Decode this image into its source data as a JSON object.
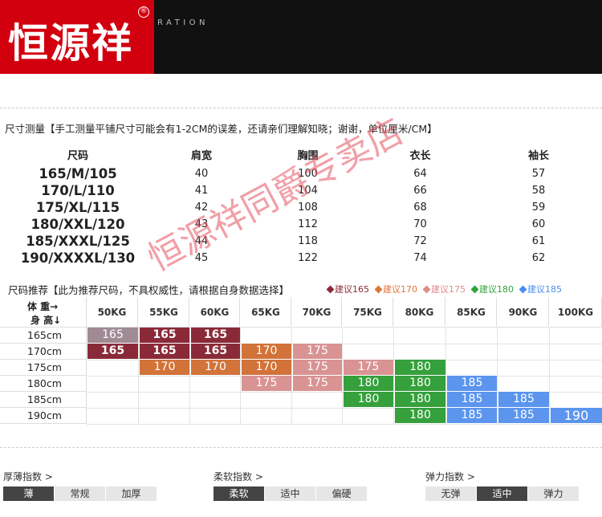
{
  "header": {
    "logo_text": "恒源祥",
    "registered_mark": "®",
    "tagline": "RATION"
  },
  "measure": {
    "title": "尺寸测量【手工测量平铺尺寸可能会有1-2CM的误差，还请亲们理解知晓；谢谢，单位厘米/CM】",
    "headers": [
      "尺码",
      "肩宽",
      "胸围",
      "衣长",
      "袖长"
    ],
    "rows": [
      [
        "165/M/105",
        "40",
        "100",
        "64",
        "57"
      ],
      [
        "170/L/110",
        "41",
        "104",
        "66",
        "58"
      ],
      [
        "175/XL/115",
        "42",
        "108",
        "68",
        "59"
      ],
      [
        "180/XXL/120",
        "43",
        "112",
        "70",
        "60"
      ],
      [
        "185/XXXL/125",
        "44",
        "118",
        "72",
        "61"
      ],
      [
        "190/XXXXL/130",
        "45",
        "122",
        "74",
        "62"
      ]
    ]
  },
  "recommend": {
    "title": "尺码推荐【此为推荐尺码，不具权威性，请根据自身数据选择】",
    "legend": [
      {
        "label": "建议165",
        "color": "#8a2a38"
      },
      {
        "label": "建议170",
        "color": "#e0753a"
      },
      {
        "label": "建议175",
        "color": "#e08a8a"
      },
      {
        "label": "建议180",
        "color": "#2ea43a"
      },
      {
        "label": "建议185",
        "color": "#4a8ef0"
      }
    ],
    "corner_weight": "体 重→",
    "corner_height": "身 高↓",
    "weights": [
      "50KG",
      "55KG",
      "60KG",
      "65KG",
      "70KG",
      "75KG",
      "80KG",
      "85KG",
      "90KG",
      "100KG"
    ],
    "heights": [
      "165cm",
      "170cm",
      "175cm",
      "180cm",
      "185cm",
      "190cm"
    ],
    "colors": {
      "165": "#8a2a38",
      "165a": "#a08a94",
      "170": "#d2733a",
      "175": "#d99393",
      "180": "#35a03c",
      "185": "#5b95ee",
      "190": "#5b95ee"
    },
    "cells": [
      {
        "row": 0,
        "col": 0,
        "label": "165",
        "tone": "165a"
      },
      {
        "row": 0,
        "col": 1,
        "label": "165",
        "tone": "165"
      },
      {
        "row": 0,
        "col": 2,
        "label": "165",
        "tone": "165"
      },
      {
        "row": 1,
        "col": 0,
        "label": "165",
        "tone": "165"
      },
      {
        "row": 1,
        "col": 1,
        "label": "165",
        "tone": "165"
      },
      {
        "row": 1,
        "col": 2,
        "label": "165",
        "tone": "165"
      },
      {
        "row": 1,
        "col": 3,
        "label": "170",
        "tone": "170"
      },
      {
        "row": 1,
        "col": 4,
        "label": "175",
        "tone": "175"
      },
      {
        "row": 2,
        "col": 1,
        "label": "170",
        "tone": "170"
      },
      {
        "row": 2,
        "col": 2,
        "label": "170",
        "tone": "170"
      },
      {
        "row": 2,
        "col": 3,
        "label": "170",
        "tone": "170"
      },
      {
        "row": 2,
        "col": 4,
        "label": "175",
        "tone": "175"
      },
      {
        "row": 2,
        "col": 5,
        "label": "175",
        "tone": "175"
      },
      {
        "row": 2,
        "col": 6,
        "label": "180",
        "tone": "180"
      },
      {
        "row": 3,
        "col": 3,
        "label": "175",
        "tone": "175"
      },
      {
        "row": 3,
        "col": 4,
        "label": "175",
        "tone": "175"
      },
      {
        "row": 3,
        "col": 5,
        "label": "180",
        "tone": "180"
      },
      {
        "row": 3,
        "col": 6,
        "label": "180",
        "tone": "180"
      },
      {
        "row": 3,
        "col": 7,
        "label": "185",
        "tone": "185"
      },
      {
        "row": 4,
        "col": 5,
        "label": "180",
        "tone": "180"
      },
      {
        "row": 4,
        "col": 6,
        "label": "180",
        "tone": "180"
      },
      {
        "row": 4,
        "col": 7,
        "label": "185",
        "tone": "185"
      },
      {
        "row": 4,
        "col": 8,
        "label": "185",
        "tone": "185"
      },
      {
        "row": 5,
        "col": 6,
        "label": "180",
        "tone": "180"
      },
      {
        "row": 5,
        "col": 7,
        "label": "185",
        "tone": "185"
      },
      {
        "row": 5,
        "col": 8,
        "label": "185",
        "tone": "185"
      },
      {
        "row": 5,
        "col": 9,
        "label": "190",
        "tone": "190"
      }
    ]
  },
  "indexes": [
    {
      "title": "厚薄指数 >",
      "options": [
        "薄",
        "常规",
        "加厚"
      ],
      "selected": 0
    },
    {
      "title": "柔软指数 >",
      "options": [
        "柔软",
        "适中",
        "偏硬"
      ],
      "selected": 0
    },
    {
      "title": "弹力指数 >",
      "options": [
        "无弹",
        "适中",
        "弹力"
      ],
      "selected": 1
    }
  ],
  "watermark": "恒源祥同爵专卖店"
}
